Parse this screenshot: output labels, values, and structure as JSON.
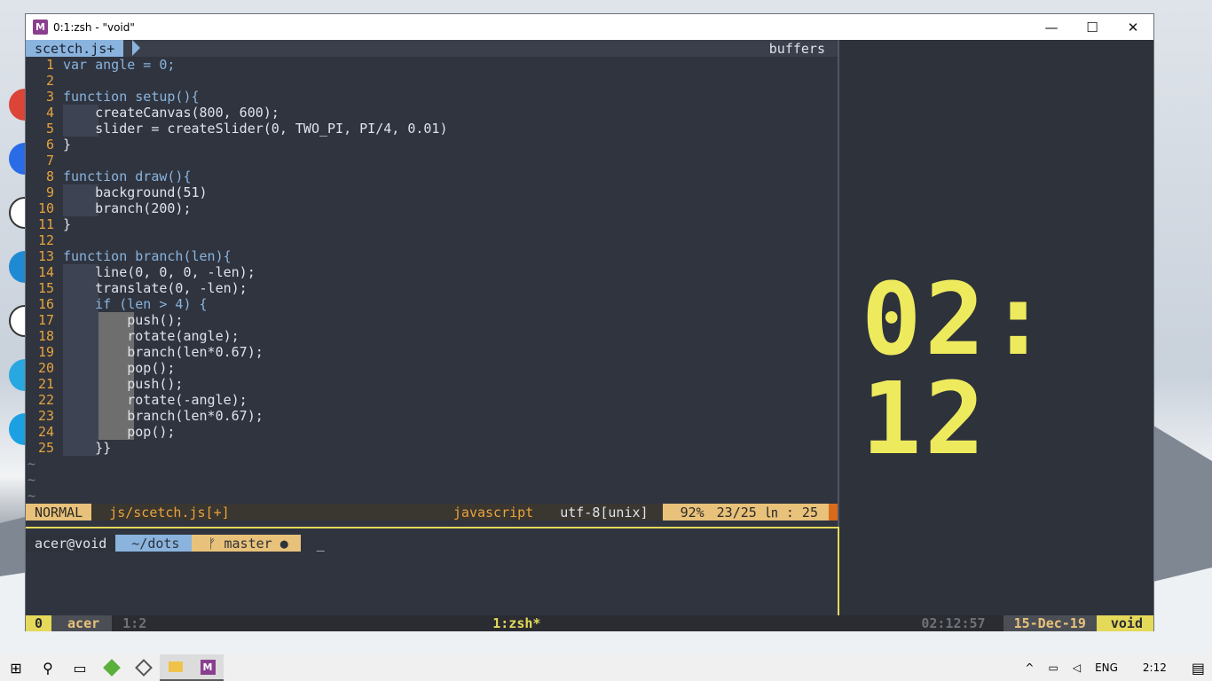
{
  "window": {
    "title": "0:1:zsh - \"void\"",
    "logo": "M",
    "minimize_icon": "—",
    "maximize_icon": "☐",
    "close_icon": "✕"
  },
  "vim": {
    "tab_label": "scetch.js+",
    "buffers_label": "buffers",
    "lines": [
      {
        "n": "1",
        "text": "var angle = 0;"
      },
      {
        "n": "2",
        "text": ""
      },
      {
        "n": "3",
        "text": "function setup(){"
      },
      {
        "n": "4",
        "text": "    createCanvas(800, 600);"
      },
      {
        "n": "5",
        "text": "    slider = createSlider(0, TWO_PI, PI/4, 0.01)"
      },
      {
        "n": "6",
        "text": "}"
      },
      {
        "n": "7",
        "text": ""
      },
      {
        "n": "8",
        "text": "function draw(){"
      },
      {
        "n": "9",
        "text": "    background(51)"
      },
      {
        "n": "10",
        "text": "    branch(200);"
      },
      {
        "n": "11",
        "text": "}"
      },
      {
        "n": "12",
        "text": ""
      },
      {
        "n": "13",
        "text": "function branch(len){"
      },
      {
        "n": "14",
        "text": "    line(0, 0, 0, -len);"
      },
      {
        "n": "15",
        "text": "    translate(0, -len);"
      },
      {
        "n": "16",
        "text": "    if (len > 4) {"
      },
      {
        "n": "17",
        "text": "        push();"
      },
      {
        "n": "18",
        "text": "        rotate(angle);"
      },
      {
        "n": "19",
        "text": "        branch(len*0.67);"
      },
      {
        "n": "20",
        "text": "        pop();"
      },
      {
        "n": "21",
        "text": "        push();"
      },
      {
        "n": "22",
        "text": "        rotate(-angle);"
      },
      {
        "n": "23",
        "text": "        branch(len*0.67);"
      },
      {
        "n": "24",
        "text": "        pop();"
      },
      {
        "n": "25",
        "text": "    }}"
      }
    ],
    "tildes": [
      "~",
      "~",
      "~"
    ],
    "status": {
      "mode": "NORMAL",
      "file": "js/scetch.js[+]",
      "filetype": "javascript",
      "encoding": "utf-8[unix]",
      "percent": "92%",
      "position": "23/25 ㏑ : 25"
    }
  },
  "clock": {
    "time": "02: 12"
  },
  "shell": {
    "user": "acer@void",
    "dir": "~/dots",
    "git": "ᚠ master ●",
    "cursor": "_"
  },
  "tmux": {
    "index": "0",
    "session": "acer",
    "pane": "1:2",
    "window": "1:zsh*",
    "time": "02:12:57",
    "date": "15-Dec-19",
    "host": "void"
  },
  "taskbar": {
    "start_icon": "⊞",
    "search_icon": "⚲",
    "taskview_icon": "▭",
    "lang": "ENG",
    "clock": "2:12",
    "chevron": "^"
  },
  "colors": {
    "accent_blue": "#8ab4de",
    "accent_yellow": "#e5d95a",
    "orange": "#e8a33c",
    "bg": "#2f343f"
  }
}
